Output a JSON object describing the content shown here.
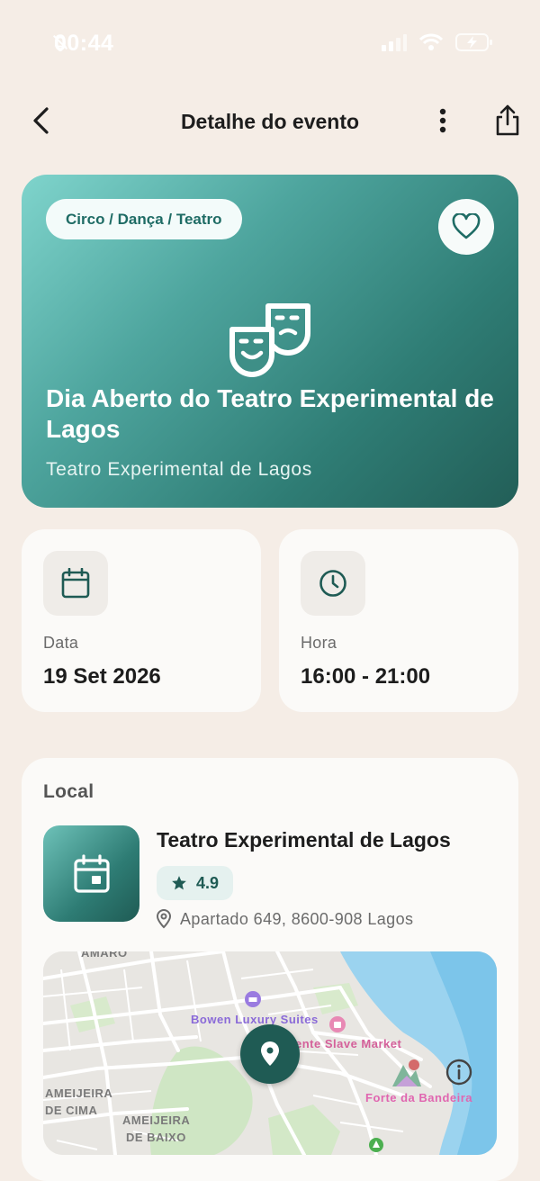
{
  "status_bar": {
    "time": "00:44"
  },
  "header": {
    "title": "Detalhe do evento"
  },
  "hero": {
    "category": "Circo / Dança / Teatro",
    "title": "Dia Aberto do Teatro Experimental de Lagos",
    "subtitle": "Teatro Experimental de Lagos"
  },
  "info": {
    "date_label": "Data",
    "date_value": "19 Set 2026",
    "time_label": "Hora",
    "time_value": "16:00 - 21:00"
  },
  "location": {
    "section_title": "Local",
    "venue_name": "Teatro Experimental de Lagos",
    "rating": "4.9",
    "address": "Apartado 649, 8600-908 Lagos",
    "map_labels": {
      "amaro": "AMARO",
      "bowen": "Bowen Luxury Suites",
      "slave_market": "ente Slave Market",
      "forte": "Forte da Bandeira",
      "ameijeira_cima_1": "AMEIJEIRA",
      "ameijeira_cima_2": "DE CIMA",
      "ameijeira_baixo_1": "AMEIJEIRA",
      "ameijeira_baixo_2": "DE BAIXO"
    }
  },
  "colors": {
    "accent": "#1f5b54",
    "background": "#f5ede6",
    "card": "#fbfaf8"
  }
}
